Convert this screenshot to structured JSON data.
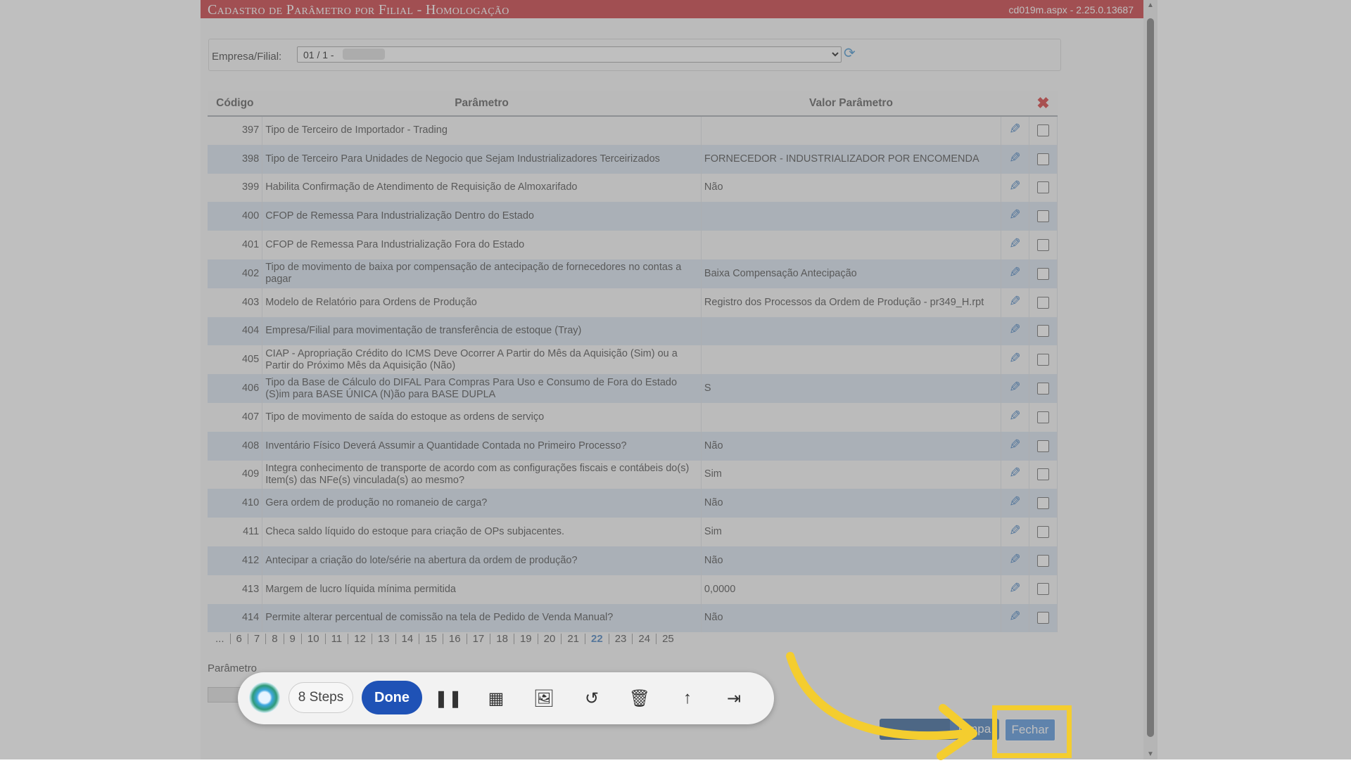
{
  "window": {
    "title": "Cadastro de Parâmetro por Filial  - Homologação",
    "version": "cd019m.aspx - 2.25.0.13687"
  },
  "filter": {
    "label": "Empresa/Filial:",
    "selected": "01 / 1 -"
  },
  "table": {
    "headers": {
      "code": "Código",
      "param": "Parâmetro",
      "value": "Valor Parâmetro"
    },
    "rows": [
      {
        "code": "397",
        "param": "Tipo de Terceiro de Importador - Trading",
        "value": ""
      },
      {
        "code": "398",
        "param": "Tipo de Terceiro Para Unidades de Negocio que Sejam Industrializadores Terceirizados",
        "value": "FORNECEDOR - INDUSTRIALIZADOR POR ENCOMENDA"
      },
      {
        "code": "399",
        "param": "Habilita Confirmação de Atendimento de Requisição de Almoxarifado",
        "value": "Não"
      },
      {
        "code": "400",
        "param": "CFOP de Remessa Para Industrialização Dentro do Estado",
        "value": ""
      },
      {
        "code": "401",
        "param": "CFOP de Remessa Para Industrialização Fora do Estado",
        "value": ""
      },
      {
        "code": "402",
        "param": "Tipo de movimento de baixa por compensação de antecipação de fornecedores no contas a pagar",
        "value": "Baixa Compensação Antecipação"
      },
      {
        "code": "403",
        "param": "Modelo de Relatório para Ordens de Produção",
        "value": "Registro dos Processos da Ordem de Produção - pr349_H.rpt"
      },
      {
        "code": "404",
        "param": "Empresa/Filial para movimentação de transferência de estoque (Tray)",
        "value": ""
      },
      {
        "code": "405",
        "param": "CIAP - Apropriação Crédito do ICMS Deve Ocorrer A Partir do Mês da Aquisição (Sim) ou a Partir do Próximo Mês da Aquisição (Não)",
        "value": ""
      },
      {
        "code": "406",
        "param": "Tipo da Base de Cálculo do DIFAL Para Compras Para Uso e Consumo de Fora do Estado (S)im para BASE ÚNICA (N)ão para BASE DUPLA",
        "value": "S"
      },
      {
        "code": "407",
        "param": "Tipo de movimento de saída do estoque as ordens de serviço",
        "value": ""
      },
      {
        "code": "408",
        "param": "Inventário Físico Deverá Assumir a Quantidade Contada no Primeiro Processo?",
        "value": "Não"
      },
      {
        "code": "409",
        "param": "Integra conhecimento de transporte de acordo com as configurações fiscais e contábeis do(s) Item(s) das NFe(s) vinculada(s) ao mesmo?",
        "value": "Sim"
      },
      {
        "code": "410",
        "param": "Gera ordem de produção no romaneio de carga?",
        "value": "Não"
      },
      {
        "code": "411",
        "param": "Checa saldo líquido do estoque para criação de OPs subjacentes.",
        "value": "Sim"
      },
      {
        "code": "412",
        "param": "Antecipar a criação do lote/série na abertura da ordem de produção?",
        "value": "Não"
      },
      {
        "code": "413",
        "param": "Margem de lucro líquida mínima permitida",
        "value": "0,0000"
      },
      {
        "code": "414",
        "param": "Permite alterar percentual de comissão na tela de Pedido de Venda Manual?",
        "value": "Não"
      }
    ]
  },
  "pager": {
    "pages": [
      "...",
      "6",
      "7",
      "8",
      "9",
      "10",
      "11",
      "12",
      "13",
      "14",
      "15",
      "16",
      "17",
      "18",
      "19",
      "20",
      "21",
      "22",
      "23",
      "24",
      "25"
    ],
    "current": "22"
  },
  "form": {
    "param_label": "Parâmetro"
  },
  "buttons": {
    "limpar": "Limpa",
    "fechar": "Fechar"
  },
  "recorder": {
    "steps": "8 Steps",
    "done": "Done"
  },
  "colors": {
    "title_bar": "#c21f25",
    "highlight": "#f4cd2f",
    "done_button": "#1f52b6"
  }
}
